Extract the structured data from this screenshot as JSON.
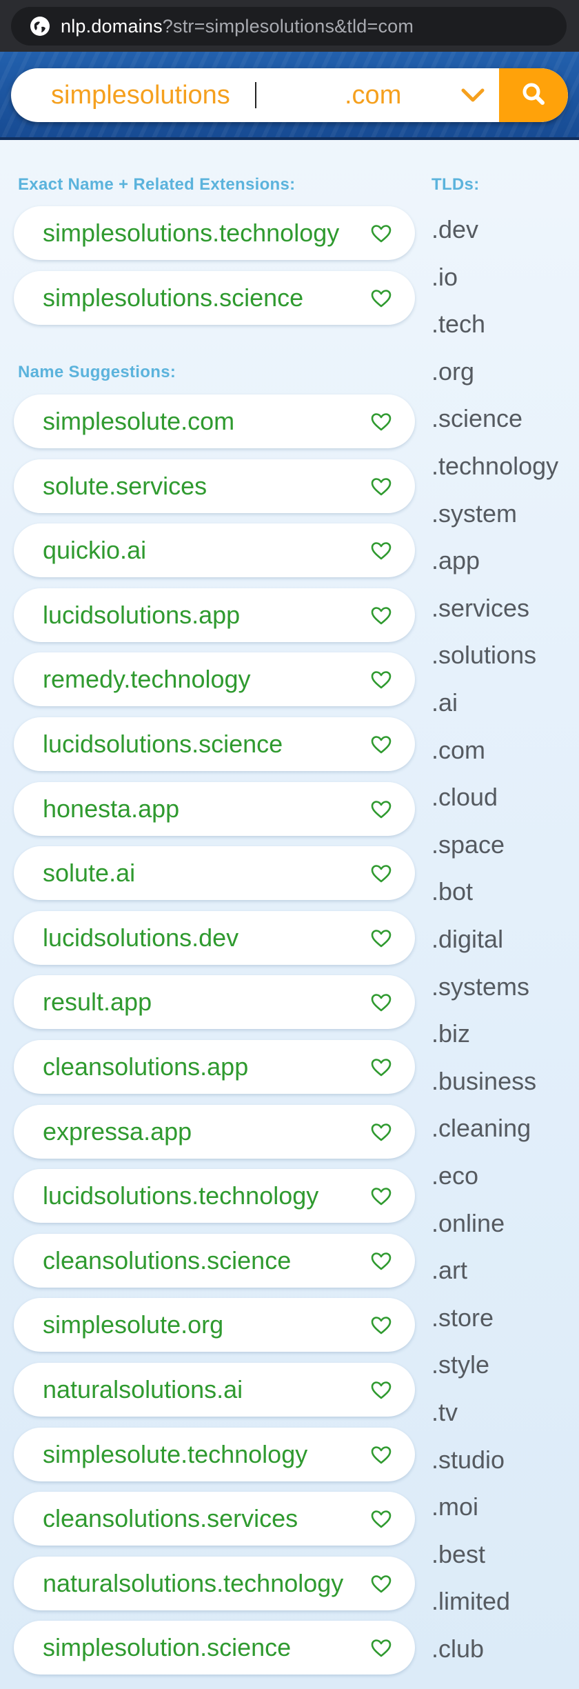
{
  "url_bar": {
    "host": "nlp.domains",
    "query": "?str=simplesolutions&tld=com",
    "site_icon": "globe-icon"
  },
  "search": {
    "value": "simplesolutions",
    "tld_selected": ".com",
    "dropdown_icon": "chevron-down-icon",
    "button_icon": "search-icon",
    "accent_color": "#ffa20a"
  },
  "sections": {
    "exact_heading": "Exact Name + Related Extensions:",
    "suggestions_heading": "Name Suggestions:",
    "tlds_heading": "TLDs:"
  },
  "exact_domains": [
    "simplesolutions.technology",
    "simplesolutions.science"
  ],
  "suggestions": [
    "simplesolute.com",
    "solute.services",
    "quickio.ai",
    "lucidsolutions.app",
    "remedy.technology",
    "lucidsolutions.science",
    "honesta.app",
    "solute.ai",
    "lucidsolutions.dev",
    "result.app",
    "cleansolutions.app",
    "expressa.app",
    "lucidsolutions.technology",
    "cleansolutions.science",
    "simplesolute.org",
    "naturalsolutions.ai",
    "simplesolute.technology",
    "cleansolutions.services",
    "naturalsolutions.technology",
    "simplesolution.science"
  ],
  "tlds": [
    ".dev",
    ".io",
    ".tech",
    ".org",
    ".science",
    ".technology",
    ".system",
    ".app",
    ".services",
    ".solutions",
    ".ai",
    ".com",
    ".cloud",
    ".space",
    ".bot",
    ".digital",
    ".systems",
    ".biz",
    ".business",
    ".cleaning",
    ".eco",
    ".online",
    ".art",
    ".store",
    ".style",
    ".tv",
    ".studio",
    ".moi",
    ".best",
    ".limited",
    ".club"
  ],
  "colors": {
    "domain_text": "#2f9a2f",
    "heading": "#5bb3dc",
    "header_band": "#1e5aa7"
  }
}
